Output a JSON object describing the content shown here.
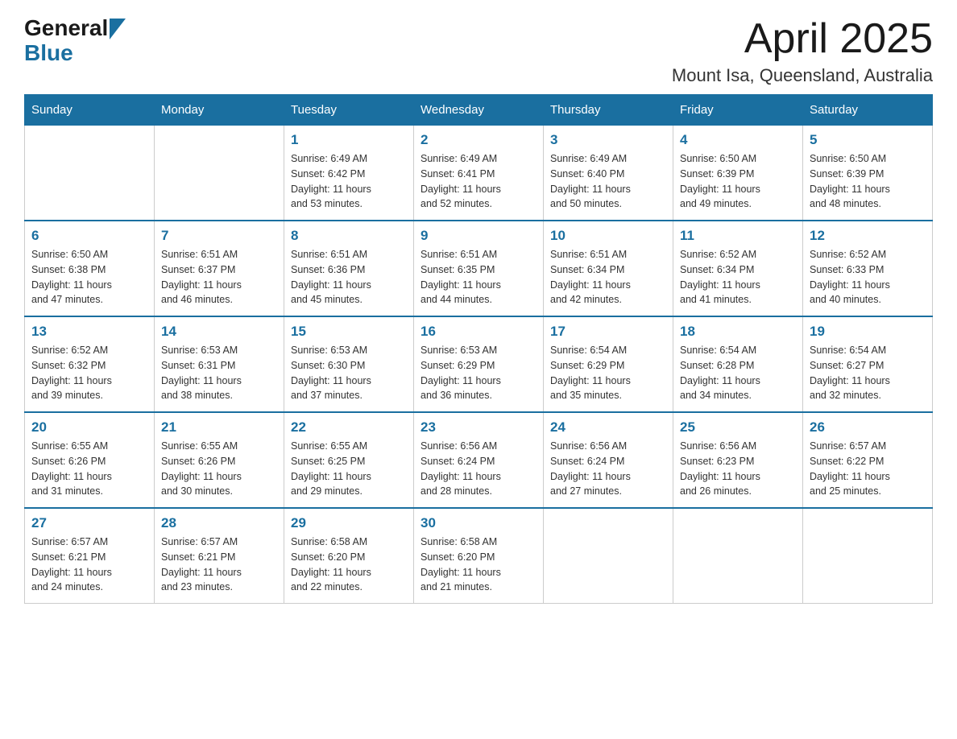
{
  "header": {
    "logo": {
      "general": "General",
      "blue": "Blue"
    },
    "title": "April 2025",
    "location": "Mount Isa, Queensland, Australia"
  },
  "calendar": {
    "days_of_week": [
      "Sunday",
      "Monday",
      "Tuesday",
      "Wednesday",
      "Thursday",
      "Friday",
      "Saturday"
    ],
    "weeks": [
      [
        {
          "day": "",
          "info": ""
        },
        {
          "day": "",
          "info": ""
        },
        {
          "day": "1",
          "info": "Sunrise: 6:49 AM\nSunset: 6:42 PM\nDaylight: 11 hours\nand 53 minutes."
        },
        {
          "day": "2",
          "info": "Sunrise: 6:49 AM\nSunset: 6:41 PM\nDaylight: 11 hours\nand 52 minutes."
        },
        {
          "day": "3",
          "info": "Sunrise: 6:49 AM\nSunset: 6:40 PM\nDaylight: 11 hours\nand 50 minutes."
        },
        {
          "day": "4",
          "info": "Sunrise: 6:50 AM\nSunset: 6:39 PM\nDaylight: 11 hours\nand 49 minutes."
        },
        {
          "day": "5",
          "info": "Sunrise: 6:50 AM\nSunset: 6:39 PM\nDaylight: 11 hours\nand 48 minutes."
        }
      ],
      [
        {
          "day": "6",
          "info": "Sunrise: 6:50 AM\nSunset: 6:38 PM\nDaylight: 11 hours\nand 47 minutes."
        },
        {
          "day": "7",
          "info": "Sunrise: 6:51 AM\nSunset: 6:37 PM\nDaylight: 11 hours\nand 46 minutes."
        },
        {
          "day": "8",
          "info": "Sunrise: 6:51 AM\nSunset: 6:36 PM\nDaylight: 11 hours\nand 45 minutes."
        },
        {
          "day": "9",
          "info": "Sunrise: 6:51 AM\nSunset: 6:35 PM\nDaylight: 11 hours\nand 44 minutes."
        },
        {
          "day": "10",
          "info": "Sunrise: 6:51 AM\nSunset: 6:34 PM\nDaylight: 11 hours\nand 42 minutes."
        },
        {
          "day": "11",
          "info": "Sunrise: 6:52 AM\nSunset: 6:34 PM\nDaylight: 11 hours\nand 41 minutes."
        },
        {
          "day": "12",
          "info": "Sunrise: 6:52 AM\nSunset: 6:33 PM\nDaylight: 11 hours\nand 40 minutes."
        }
      ],
      [
        {
          "day": "13",
          "info": "Sunrise: 6:52 AM\nSunset: 6:32 PM\nDaylight: 11 hours\nand 39 minutes."
        },
        {
          "day": "14",
          "info": "Sunrise: 6:53 AM\nSunset: 6:31 PM\nDaylight: 11 hours\nand 38 minutes."
        },
        {
          "day": "15",
          "info": "Sunrise: 6:53 AM\nSunset: 6:30 PM\nDaylight: 11 hours\nand 37 minutes."
        },
        {
          "day": "16",
          "info": "Sunrise: 6:53 AM\nSunset: 6:29 PM\nDaylight: 11 hours\nand 36 minutes."
        },
        {
          "day": "17",
          "info": "Sunrise: 6:54 AM\nSunset: 6:29 PM\nDaylight: 11 hours\nand 35 minutes."
        },
        {
          "day": "18",
          "info": "Sunrise: 6:54 AM\nSunset: 6:28 PM\nDaylight: 11 hours\nand 34 minutes."
        },
        {
          "day": "19",
          "info": "Sunrise: 6:54 AM\nSunset: 6:27 PM\nDaylight: 11 hours\nand 32 minutes."
        }
      ],
      [
        {
          "day": "20",
          "info": "Sunrise: 6:55 AM\nSunset: 6:26 PM\nDaylight: 11 hours\nand 31 minutes."
        },
        {
          "day": "21",
          "info": "Sunrise: 6:55 AM\nSunset: 6:26 PM\nDaylight: 11 hours\nand 30 minutes."
        },
        {
          "day": "22",
          "info": "Sunrise: 6:55 AM\nSunset: 6:25 PM\nDaylight: 11 hours\nand 29 minutes."
        },
        {
          "day": "23",
          "info": "Sunrise: 6:56 AM\nSunset: 6:24 PM\nDaylight: 11 hours\nand 28 minutes."
        },
        {
          "day": "24",
          "info": "Sunrise: 6:56 AM\nSunset: 6:24 PM\nDaylight: 11 hours\nand 27 minutes."
        },
        {
          "day": "25",
          "info": "Sunrise: 6:56 AM\nSunset: 6:23 PM\nDaylight: 11 hours\nand 26 minutes."
        },
        {
          "day": "26",
          "info": "Sunrise: 6:57 AM\nSunset: 6:22 PM\nDaylight: 11 hours\nand 25 minutes."
        }
      ],
      [
        {
          "day": "27",
          "info": "Sunrise: 6:57 AM\nSunset: 6:21 PM\nDaylight: 11 hours\nand 24 minutes."
        },
        {
          "day": "28",
          "info": "Sunrise: 6:57 AM\nSunset: 6:21 PM\nDaylight: 11 hours\nand 23 minutes."
        },
        {
          "day": "29",
          "info": "Sunrise: 6:58 AM\nSunset: 6:20 PM\nDaylight: 11 hours\nand 22 minutes."
        },
        {
          "day": "30",
          "info": "Sunrise: 6:58 AM\nSunset: 6:20 PM\nDaylight: 11 hours\nand 21 minutes."
        },
        {
          "day": "",
          "info": ""
        },
        {
          "day": "",
          "info": ""
        },
        {
          "day": "",
          "info": ""
        }
      ]
    ]
  }
}
